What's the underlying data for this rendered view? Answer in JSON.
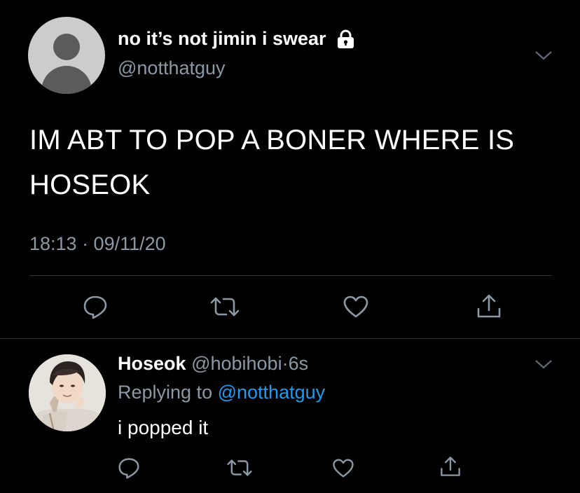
{
  "main_tweet": {
    "display_name": "no it’s not jimin i swear",
    "handle": "@notthatguy",
    "text": "IM ABT TO POP A BONER WHERE IS HOSEOK",
    "timestamp": "18:13 · 09/11/20",
    "icons": [
      "lock-icon",
      "chevron-down-icon",
      "reply-icon",
      "retweet-icon",
      "like-icon",
      "share-icon"
    ]
  },
  "reply_tweet": {
    "display_name": "Hoseok",
    "handle": "@hobihobi",
    "separator": "·",
    "time": "6s",
    "replying_prefix": "Replying to",
    "replying_handle": "@notthatguy",
    "text": "i popped it",
    "icons": [
      "chevron-down-icon",
      "reply-icon",
      "retweet-icon",
      "like-icon",
      "share-icon"
    ]
  },
  "colors": {
    "background": "#000000",
    "text_primary": "#ffffff",
    "text_secondary": "#8b98a5",
    "link": "#1d9bf0",
    "divider": "#2f3336"
  }
}
